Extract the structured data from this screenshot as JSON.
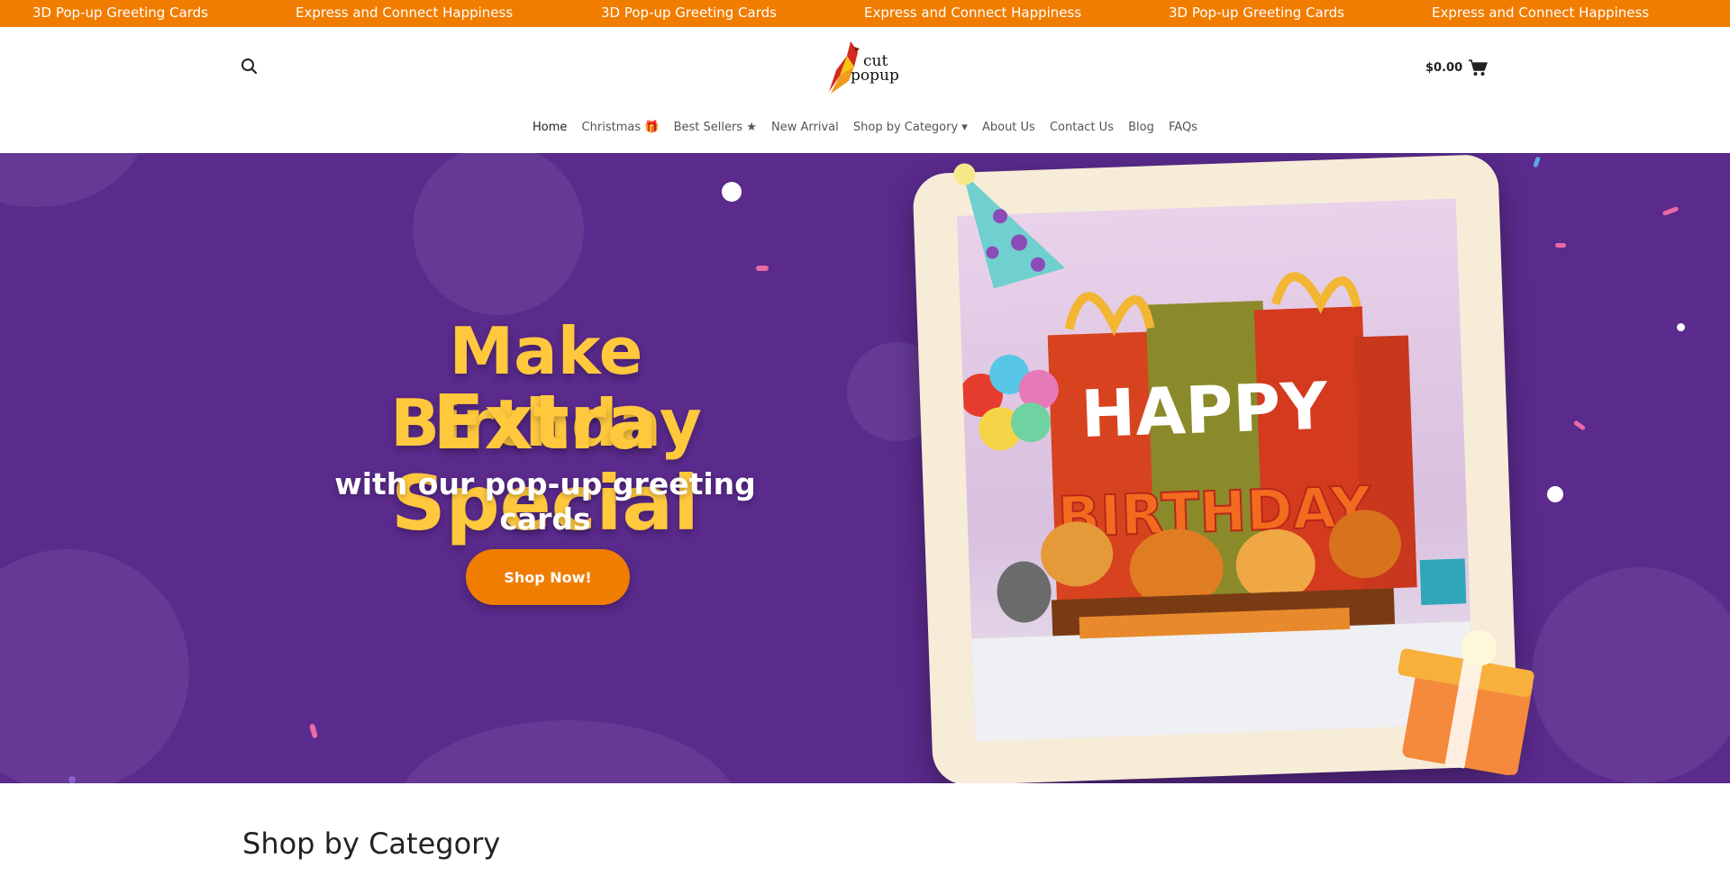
{
  "topbar": {
    "items": [
      "3D Pop-up Greeting Cards",
      "Express and Connect Happiness",
      "3D Pop-up Greeting Cards",
      "Express and Connect Happiness",
      "3D Pop-up Greeting Cards",
      "Express and Connect Happiness"
    ],
    "background": "#f07d00"
  },
  "header": {
    "logo": {
      "line1": "cut",
      "line2": "popup"
    },
    "cart_amount": "$0.00",
    "search_icon": "search-icon",
    "cart_icon": "cart-icon"
  },
  "nav": {
    "items": [
      {
        "label": "Home"
      },
      {
        "label": "Christmas 🎁"
      },
      {
        "label": "Best Sellers ★"
      },
      {
        "label": "New Arrival"
      },
      {
        "label": "Shop by Category ▾"
      },
      {
        "label": "About Us"
      },
      {
        "label": "Contact Us"
      },
      {
        "label": "Blog"
      },
      {
        "label": "FAQs"
      }
    ]
  },
  "hero": {
    "headline_line1": "Make Birthday",
    "headline_line2": "Extra Special",
    "subline": "with our pop-up greeting  cards",
    "cta_label": "Shop Now!",
    "background": "#5a2a8c",
    "headline_color": "#ffc83d",
    "cta_color": "#f07d00",
    "card_text": {
      "happy": "HAPPY",
      "birthday": "BIRTHDAY"
    }
  },
  "section": {
    "title": "Shop by Category"
  }
}
